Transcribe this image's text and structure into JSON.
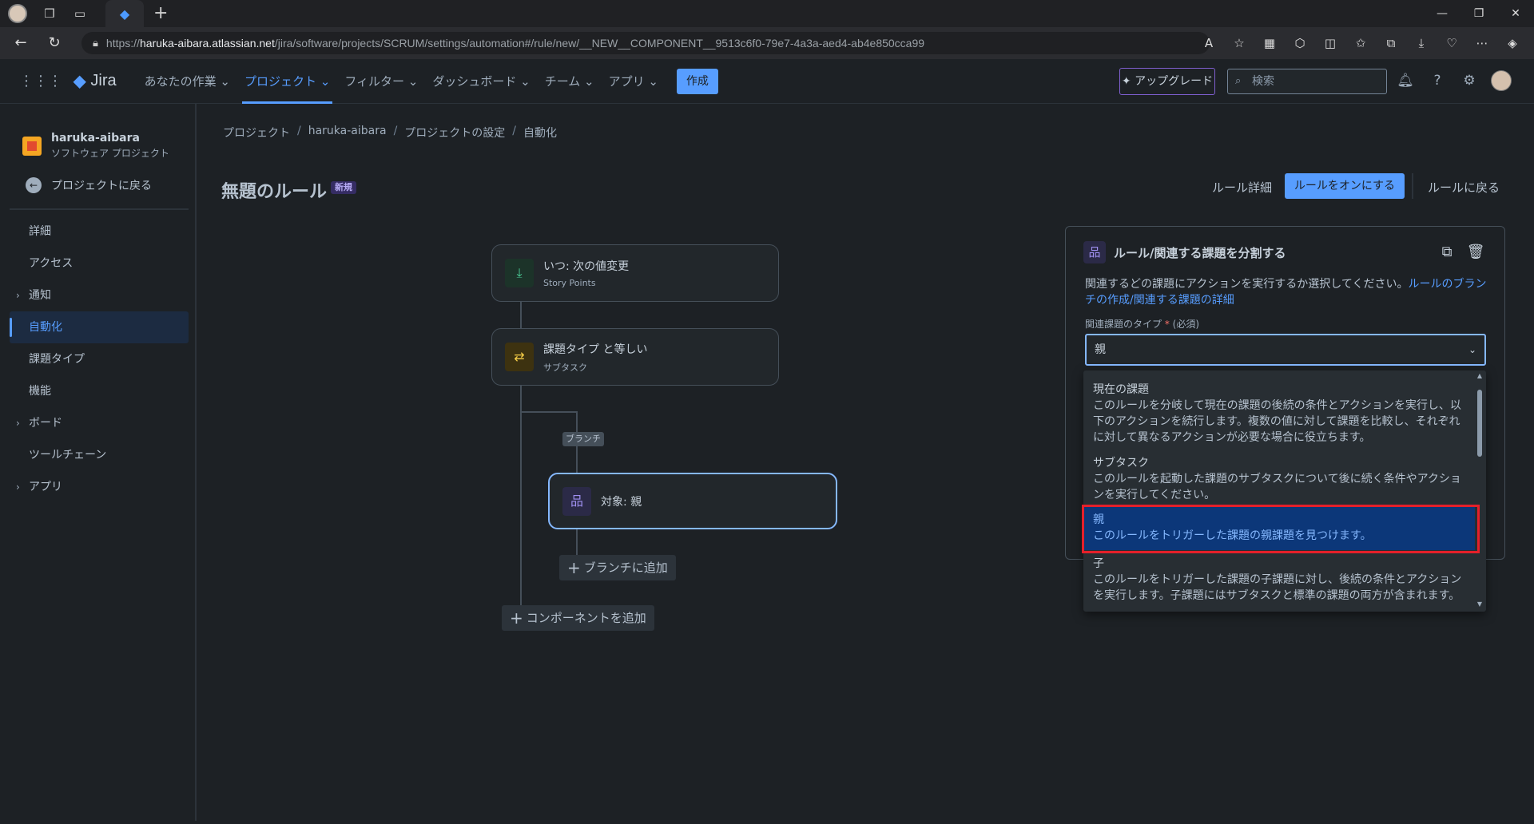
{
  "browser": {
    "url_prefix": "https://",
    "url_host": "haruka-aibara.atlassian.net",
    "url_path": "/jira/software/projects/SCRUM/settings/automation#/rule/new/__NEW__COMPONENT__9513c6f0-79e7-4a3a-aed4-ab4e850cca99"
  },
  "topnav": {
    "brand": "Jira",
    "items": [
      {
        "label": "あなたの作業 ⌄"
      },
      {
        "label": "プロジェクト ⌄"
      },
      {
        "label": "フィルター ⌄"
      },
      {
        "label": "ダッシュボード ⌄"
      },
      {
        "label": "チーム ⌄"
      },
      {
        "label": "アプリ ⌄"
      }
    ],
    "create": "作成",
    "upgrade": "アップグレード",
    "search_placeholder": "検索"
  },
  "sidebar": {
    "project_name": "haruka-aibara",
    "project_type": "ソフトウェア プロジェクト",
    "back": "プロジェクトに戻る",
    "items": [
      {
        "label": "詳細"
      },
      {
        "label": "アクセス"
      },
      {
        "label": "通知"
      },
      {
        "label": "自動化"
      },
      {
        "label": "課題タイプ"
      },
      {
        "label": "機能"
      },
      {
        "label": "ボード"
      },
      {
        "label": "ツールチェーン"
      },
      {
        "label": "アプリ"
      }
    ]
  },
  "breadcrumb": [
    "プロジェクト",
    "haruka-aibara",
    "プロジェクトの設定",
    "自動化"
  ],
  "rule": {
    "title": "無題のルール",
    "badge": "新規",
    "details": "ルール詳細",
    "enable": "ルールをオンにする",
    "back": "ルールに戻る"
  },
  "flow": {
    "trigger_title": "いつ: 次の値変更",
    "trigger_sub": "Story Points",
    "condition_title": "課題タイプ と等しい",
    "condition_sub": "サブタスク",
    "branch_label": "ブランチ",
    "branch_title": "対象: 親",
    "add_branch": "ブランチに追加",
    "add_component": "コンポーネントを追加"
  },
  "panel": {
    "title": "ルール/関連する課題を分割する",
    "desc": "関連するどの課題にアクションを実行するか選択してください。",
    "desc_link": "ルールのブランチの作成/関連する課題の詳細",
    "field_label": "関連課題のタイプ",
    "field_req": "*",
    "field_note": "(必須)",
    "value": "親"
  },
  "dropdown": {
    "options": [
      {
        "label": "現在の課題",
        "desc": "このルールを分岐して現在の課題の後続の条件とアクションを実行し、以下のアクションを続行します。複数の値に対して課題を比較し、それぞれに対して異なるアクションが必要な場合に役立ちます。"
      },
      {
        "label": "サブタスク",
        "desc": "このルールを起動した課題のサブタスクについて後に続く条件やアクションを実行してください。"
      },
      {
        "label": "親",
        "desc": "このルールをトリガーした課題の親課題を見つけます。"
      },
      {
        "label": "子",
        "desc": "このルールをトリガーした課題の子課題に対し、後続の条件とアクションを実行します。子課題にはサブタスクと標準の課題の両方が含まれます。"
      }
    ]
  }
}
